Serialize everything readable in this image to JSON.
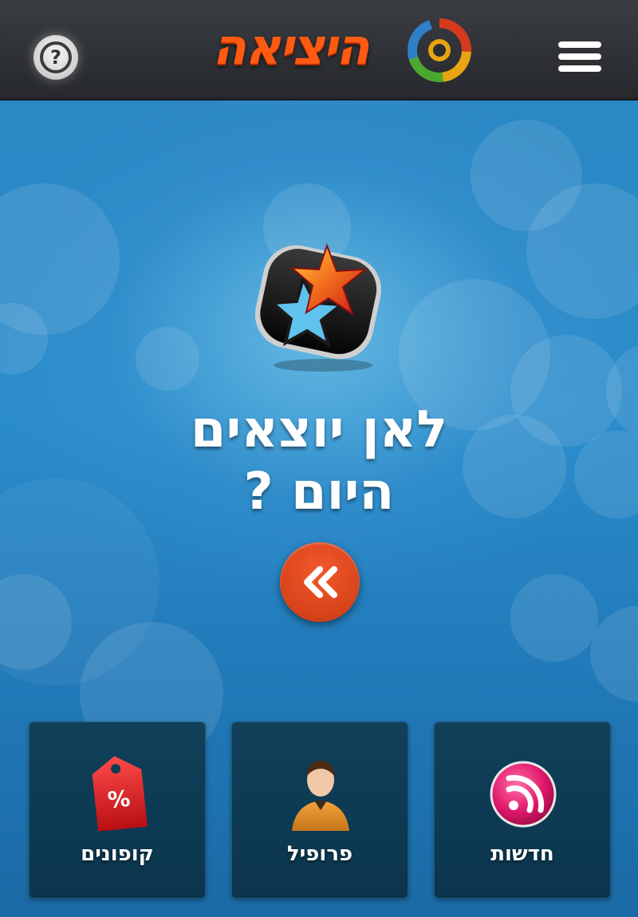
{
  "header": {
    "logo_text": "היציאה",
    "help_icon": "question-mark-icon",
    "menu_icon": "hamburger-menu-icon",
    "help_glyph": "?"
  },
  "hero": {
    "icon": "star-app-icon",
    "headline_line1": "לאן יוצאים",
    "headline_line2": "היום ?",
    "go_icon": "double-chevron-left-icon"
  },
  "tiles": [
    {
      "label": "קופונים",
      "icon": "coupon-tag-icon",
      "tag_text": "%"
    },
    {
      "label": "פרופיל",
      "icon": "user-profile-icon"
    },
    {
      "label": "חדשות",
      "icon": "rss-feed-icon"
    }
  ],
  "colors": {
    "header_bg": "#2b2d31",
    "background": "#2a86c2",
    "accent_orange": "#e04a1f",
    "tile_bg": "#0e3b54",
    "logo_orange": "#ff5a12"
  }
}
